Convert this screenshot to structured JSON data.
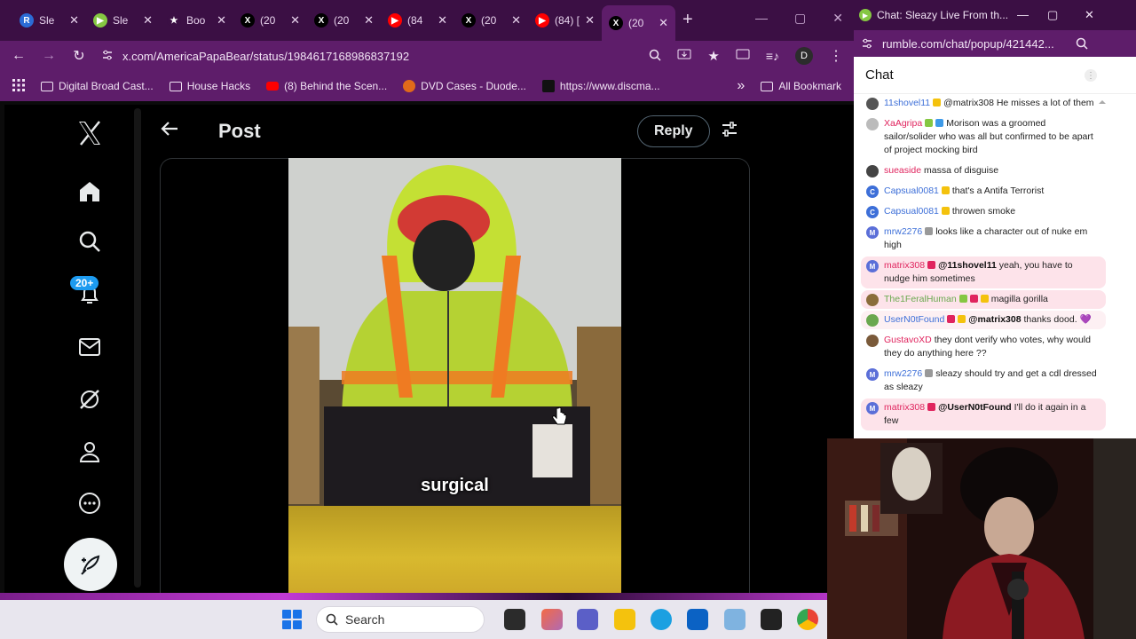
{
  "browser": {
    "tabs": [
      {
        "label": "Sle",
        "icon": "rumble-r-icon",
        "color": "#2b6cd6",
        "letter": "R"
      },
      {
        "label": "Sle",
        "icon": "rumble-play-icon",
        "color": "#85c742",
        "letter": "▶"
      },
      {
        "label": "Boo",
        "icon": "star-icon",
        "color": "#3b0f44",
        "letter": "★"
      },
      {
        "label": "(20",
        "icon": "x-logo-icon",
        "color": "#000000",
        "letter": "X"
      },
      {
        "label": "(20",
        "icon": "x-logo-icon",
        "color": "#000000",
        "letter": "X"
      },
      {
        "label": "(84",
        "icon": "youtube-icon",
        "color": "#ff0000",
        "letter": "▶"
      },
      {
        "label": "(20",
        "icon": "x-logo-icon",
        "color": "#000000",
        "letter": "X"
      },
      {
        "label": "(84) [C",
        "icon": "youtube-icon",
        "color": "#ff0000",
        "letter": "▶"
      },
      {
        "label": "(20",
        "icon": "x-logo-icon",
        "color": "#000000",
        "letter": "X",
        "active": true
      }
    ],
    "url": "x.com/AmericaPapaBear/status/1984617168986837192",
    "profile_letter": "D",
    "bookmarks": [
      {
        "label": "Digital Broad Cast...",
        "icon": "folder-icon"
      },
      {
        "label": "House Hacks",
        "icon": "folder-icon"
      },
      {
        "label": "(8) Behind the Scen...",
        "icon": "youtube-icon"
      },
      {
        "label": "DVD Cases - Duode...",
        "icon": "dvd-icon"
      },
      {
        "label": "https://www.discma...",
        "icon": "discma-icon"
      }
    ],
    "all_bookmarks": "All Bookmark"
  },
  "x": {
    "post_title": "Post",
    "reply_label": "Reply",
    "notif_badge": "20+",
    "video_caption": "surgical"
  },
  "taskbar": {
    "search_placeholder": "Search"
  },
  "chat": {
    "window_title": "Chat: Sleazy Live From th...",
    "url": "rumble.com/chat/popup/421442...",
    "header": "Chat",
    "messages": [
      {
        "user": "11shovel11",
        "user_color": "#3d6fd8",
        "text": "@matrix308 He misses a lot of them",
        "av": "#555",
        "av_letter": "",
        "badges": [
          "#f4c20d"
        ]
      },
      {
        "user": "XaAgripa",
        "user_color": "#e0245e",
        "text": "Morison was a groomed sailor/solider who was all but confirmed to be apart of project mocking bird",
        "av": "#bbb",
        "av_letter": "",
        "badges": [
          "#85c742",
          "#3d9ae8"
        ]
      },
      {
        "user": "sueaside",
        "user_color": "#e0245e",
        "text": "massa of disguise",
        "av": "#444",
        "av_letter": "",
        "badges": []
      },
      {
        "user": "Capsual0081",
        "user_color": "#3d6fd8",
        "text": "that's a Antifa Terrorist",
        "av": "#3d6fd8",
        "av_letter": "C",
        "badges": [
          "#f4c20d"
        ]
      },
      {
        "user": "Capsual0081",
        "user_color": "#3d6fd8",
        "text": "throwen smoke",
        "av": "#3d6fd8",
        "av_letter": "C",
        "badges": [
          "#f4c20d"
        ]
      },
      {
        "user": "mrw2276",
        "user_color": "#3d6fd8",
        "text": "looks like a character out of nuke em high",
        "av": "#5b6fd8",
        "av_letter": "M",
        "badges": [
          "#999"
        ]
      },
      {
        "user": "matrix308",
        "user_color": "#e0245e",
        "text": "yeah, you have to nudge him sometimes",
        "mention": "@11shovel11",
        "av": "#5b6fd8",
        "av_letter": "M",
        "badges": [
          "#e0245e"
        ],
        "highlight": "hl"
      },
      {
        "user": "The1FeralHuman",
        "user_color": "#6aa84f",
        "text": "magilla gorilla",
        "av": "#8a6d3b",
        "av_letter": "",
        "badges": [
          "#85c742",
          "#e0245e",
          "#f4c20d"
        ],
        "highlight": "hl"
      },
      {
        "user": "UserN0tFound",
        "user_color": "#3d6fd8",
        "text": "thanks dood. 💜",
        "mention": "@matrix308",
        "av": "#6aa84f",
        "av_letter": "",
        "badges": [
          "#e0245e",
          "#f4c20d"
        ],
        "highlight": "hl2"
      },
      {
        "user": "GustavoXD",
        "user_color": "#e0245e",
        "text": "they dont verify who votes, why would they do anything here ??",
        "av": "#7a5a3a",
        "av_letter": "",
        "badges": []
      },
      {
        "user": "mrw2276",
        "user_color": "#3d6fd8",
        "text": "sleazy should try and get a cdl dressed as sleazy",
        "av": "#5b6fd8",
        "av_letter": "M",
        "badges": [
          "#999"
        ]
      },
      {
        "user": "matrix308",
        "user_color": "#e0245e",
        "text": "I'll do it again in a few",
        "mention": "@UserN0tFound",
        "av": "#5b6fd8",
        "av_letter": "M",
        "badges": [
          "#e0245e"
        ],
        "highlight": "hl"
      }
    ]
  },
  "colors": {
    "x_blue": "#1d9bf0",
    "browser_frame": "#5e1d6a",
    "tab_strip": "#3b0f44",
    "hivis_yellow": "#c8e637",
    "hivis_orange": "#f07a1e"
  }
}
